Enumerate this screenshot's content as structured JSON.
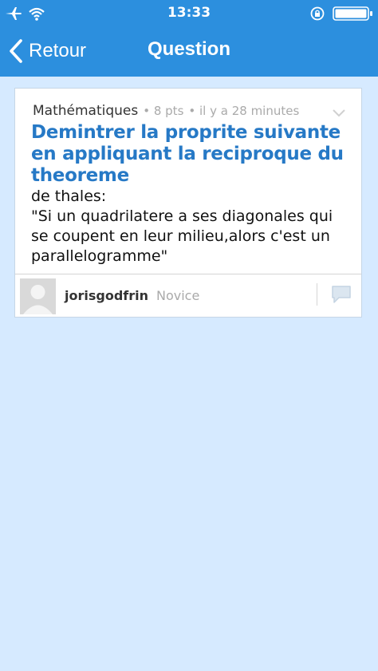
{
  "status_bar": {
    "time": "13:33"
  },
  "nav": {
    "back_label": "Retour",
    "title": "Question"
  },
  "question": {
    "subject": "Mathématiques",
    "points": "• 8 pts",
    "time_ago": "• il y a 28 minutes",
    "title": "Demintrer la proprite suivante en appliquant la reciproque du theoreme",
    "body": " de thales:\n \"Si un quadrilatere a ses diagonales qui se coupent en leur milieu,alors c'est un parallelogramme\""
  },
  "author": {
    "username": "jorisgodfrin",
    "rank": "Novice"
  },
  "colors": {
    "header": "#2c8fde",
    "background": "#d6eaff",
    "title": "#2679c6"
  }
}
